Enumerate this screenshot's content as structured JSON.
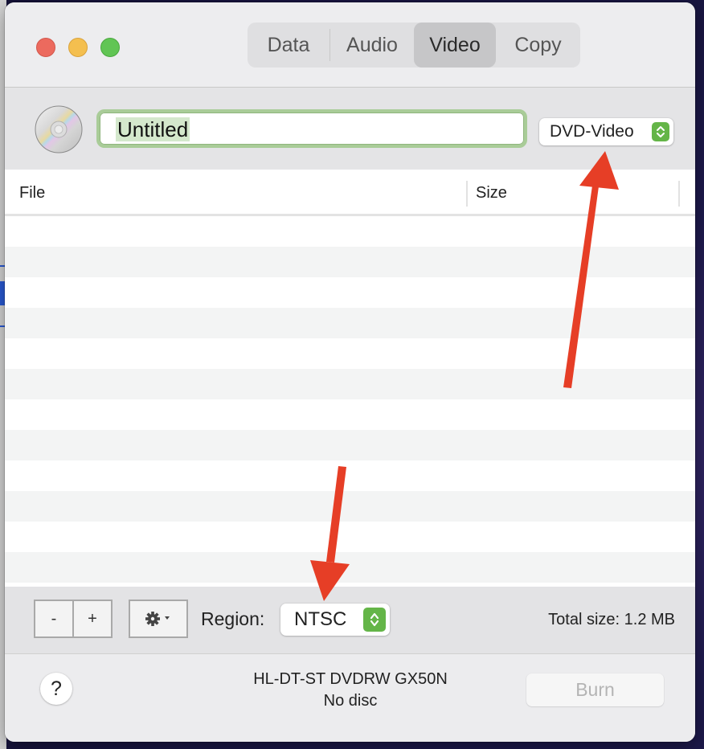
{
  "window": {
    "traffic_lights": [
      "close",
      "minimize",
      "zoom"
    ],
    "tabs": [
      {
        "label": "Data",
        "active": false
      },
      {
        "label": "Audio",
        "active": false
      },
      {
        "label": "Video",
        "active": true
      },
      {
        "label": "Copy",
        "active": false
      }
    ]
  },
  "disc_bar": {
    "icon": "disc-icon",
    "name_value": "Untitled",
    "format_popup": "DVD-Video"
  },
  "table": {
    "columns": [
      "File",
      "Size"
    ],
    "rows": []
  },
  "toolbar": {
    "remove_label": "-",
    "add_label": "+",
    "actions_icon": "gear-icon",
    "region_label": "Region:",
    "region_value": "NTSC",
    "total_size": "Total size: 1.2 MB"
  },
  "footer": {
    "help_label": "?",
    "drive_name": "HL-DT-ST DVDRW GX50N",
    "disc_status": "No disc",
    "burn_label": "Burn",
    "burn_enabled": false
  },
  "annotations": {
    "arrow_color": "#e63e26",
    "arrows": [
      "pointing-to-format-popup",
      "pointing-to-region-popup"
    ]
  },
  "colors": {
    "accent_green": "#64b548",
    "focus_ring": "#a9cc98",
    "selection": "#d4e8cc"
  }
}
